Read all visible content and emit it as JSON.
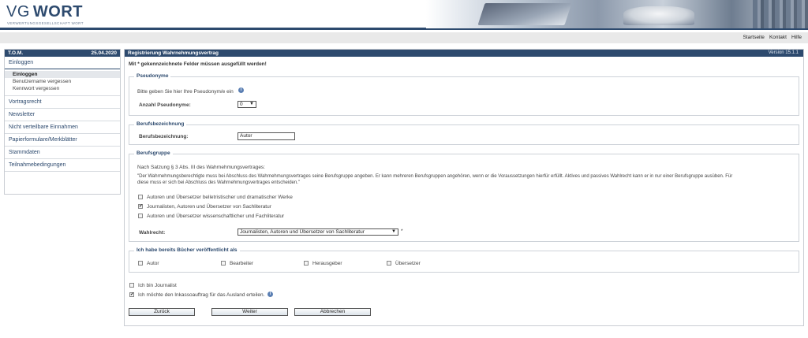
{
  "header": {
    "logo_vg": "VG",
    "logo_wort": "WORT",
    "logo_sub": "VERWERTUNGSGESELLSCHAFT WORT"
  },
  "toplinks": [
    "Startseite",
    "Kontakt",
    "Hilfe"
  ],
  "sidebar": {
    "title": "T.O.M.",
    "date": "25.04.2020",
    "items": [
      {
        "label": "Einloggen"
      },
      {
        "label": "Vortragsrecht"
      },
      {
        "label": "Newsletter"
      },
      {
        "label": "Nicht verteilbare Einnahmen"
      },
      {
        "label": "Papierformulare/Merkblätter"
      },
      {
        "label": "Stammdaten"
      },
      {
        "label": "Teilnahmebedingungen"
      }
    ],
    "subitems": [
      "Einloggen",
      "Benutzername vergessen",
      "Kennwort vergessen"
    ]
  },
  "main": {
    "title": "Registrierung Wahrnehmungsvertrag",
    "version": "Version 15.1.1",
    "required_note": "Mit * gekennzeichnete Felder müssen ausgefüllt werden!",
    "pseudonyme": {
      "legend": "Pseudonyme",
      "hint": "Bitte geben Sie hier Ihre Pseudonym/e ein",
      "count_label": "Anzahl Pseudonyme:",
      "count_value": "0"
    },
    "beruf": {
      "legend": "Berufsbezeichnung",
      "label": "Berufsbezeichnung:",
      "value": "Autor"
    },
    "gruppe": {
      "legend": "Berufsgruppe",
      "intro": "Nach Satzung § 3 Abs. III des Wahrnehmungsvertrages:",
      "quote1": "\"Der Wahrnehmungsberechtigte muss bei Abschluss des Wahrnehmungsvertrages seine Berufsgruppe angeben. Er kann mehreren Berufsgruppen angehören, wenn er die Voraussetzungen hierfür erfüllt. Aktives und passives Wahlrecht kann er in nur einer Berufsgruppe ausüben. Für",
      "quote2": "diese muss er sich bei Abschluss des Wahrnehmungsvertrages entscheiden.\"",
      "options": [
        {
          "label": "Autoren und Übersetzer belletristischer und dramatischer Werke",
          "checked": false
        },
        {
          "label": "Journalisten, Autoren und Übersetzer von Sachliteratur",
          "checked": true
        },
        {
          "label": "Autoren und Übersetzer wissenschaftlicher und Fachliteratur",
          "checked": false
        }
      ],
      "wahlrecht_label": "Wahlrecht:",
      "wahlrecht_value": "Journalisten, Autoren und Übersetzer von Sachliteratur",
      "required_mark": "*"
    },
    "buecher": {
      "legend": "Ich habe bereits Bücher veröffentlicht als",
      "options": [
        "Autor",
        "Bearbeiter",
        "Herausgeber",
        "Übersetzer"
      ]
    },
    "extra": [
      {
        "label": "Ich bin Journalist",
        "checked": false
      },
      {
        "label": "Ich möchte den Inkassoauftrag für das Ausland erteilen.",
        "checked": true
      }
    ],
    "buttons": {
      "back": "Zurück",
      "next": "Weiter",
      "cancel": "Abbrechen"
    },
    "info_glyph": "i"
  },
  "colors": {
    "brand": "#2d4a6e",
    "panel_border": "#c9cdd3",
    "info_blue": "#5b7fb3"
  }
}
